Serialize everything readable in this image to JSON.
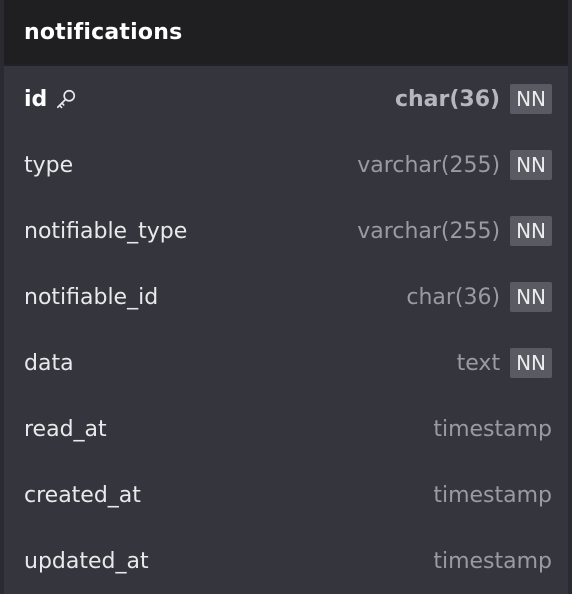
{
  "table": {
    "title": "notifications",
    "columns": [
      {
        "name": "id",
        "type": "char(36)",
        "nn": "NN",
        "primary_key": true
      },
      {
        "name": "type",
        "type": "varchar(255)",
        "nn": "NN"
      },
      {
        "name": "notifiable_type",
        "type": "varchar(255)",
        "nn": "NN"
      },
      {
        "name": "notifiable_id",
        "type": "char(36)",
        "nn": "NN"
      },
      {
        "name": "data",
        "type": "text",
        "nn": "NN"
      },
      {
        "name": "read_at",
        "type": "timestamp",
        "nn": ""
      },
      {
        "name": "created_at",
        "type": "timestamp",
        "nn": ""
      },
      {
        "name": "updated_at",
        "type": "timestamp",
        "nn": ""
      }
    ]
  },
  "icons": {
    "primary_key": "key-icon"
  },
  "colors": {
    "header_bg": "#1f1f21",
    "body_bg": "#35363d",
    "badge_bg": "#5a5b62"
  }
}
